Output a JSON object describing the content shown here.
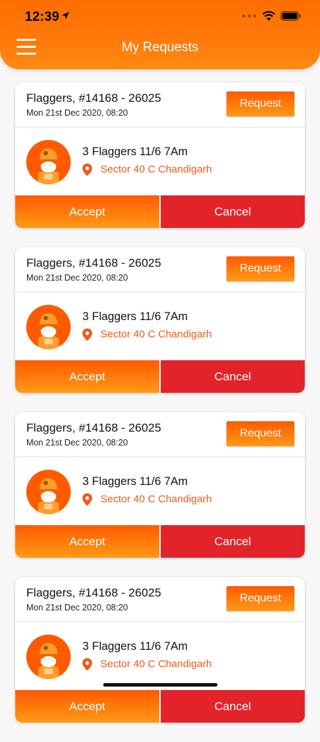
{
  "status_bar": {
    "time": "12:39",
    "icons": [
      "location-arrow-icon",
      "camera-dots-icon",
      "wifi-icon",
      "battery-icon"
    ]
  },
  "header": {
    "title": "My Requests",
    "menu_icon": "hamburger-menu-icon"
  },
  "colors": {
    "header_orange": "#ff7a0c",
    "accent_orange": "#ff5a00",
    "cancel_red": "#e2232a",
    "location_text": "#f05a1a"
  },
  "requests": [
    {
      "title": "Flaggers, #14168 - 26025",
      "date": "Mon 21st Dec 2020, 08:20",
      "request_label": "Request",
      "job": "3 Flaggers 11/6 7Am",
      "location": "Sector 40 C Chandigarh",
      "accept_label": "Accept",
      "cancel_label": "Cancel"
    },
    {
      "title": "Flaggers, #14168 - 26025",
      "date": "Mon 21st Dec 2020, 08:20",
      "request_label": "Request",
      "job": "3 Flaggers 11/6 7Am",
      "location": "Sector 40 C Chandigarh",
      "accept_label": "Accept",
      "cancel_label": "Cancel"
    },
    {
      "title": "Flaggers, #14168 - 26025",
      "date": "Mon 21st Dec 2020, 08:20",
      "request_label": "Request",
      "job": "3 Flaggers 11/6 7Am",
      "location": "Sector 40 C Chandigarh",
      "accept_label": "Accept",
      "cancel_label": "Cancel"
    },
    {
      "title": "Flaggers, #14168 - 26025",
      "date": "Mon 21st Dec 2020, 08:20",
      "request_label": "Request",
      "job": "3 Flaggers 11/6 7Am",
      "location": "Sector 40 C Chandigarh",
      "accept_label": "Accept",
      "cancel_label": "Cancel"
    }
  ]
}
